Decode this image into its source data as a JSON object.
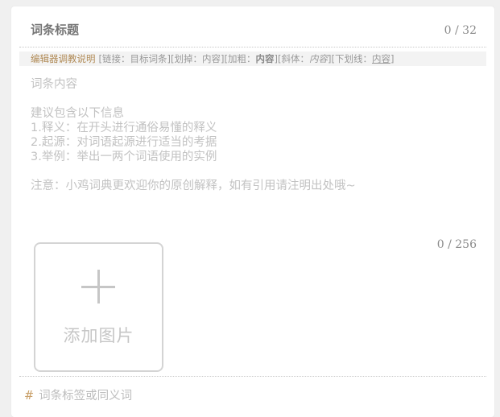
{
  "title": {
    "placeholder": "词条标题",
    "count": "0 / 32"
  },
  "toolbar": {
    "help_label": "编辑器调教说明",
    "link_open": "[链接：",
    "link_value": "目标词条",
    "link_close": "]",
    "strike_open": "[划掉：",
    "strike_value": "内容",
    "strike_close": "]",
    "bold_open": "[加粗：",
    "bold_value": "内容",
    "bold_close": "]",
    "italic_open": "[斜体：",
    "italic_value": "内容",
    "italic_close": "]",
    "underline_open": "[下划线：",
    "underline_value": "内容",
    "underline_close": "]"
  },
  "content": {
    "placeholder_lines": [
      "词条内容",
      "",
      "建议包含以下信息",
      "1.释义：在开头进行通俗易懂的释义",
      "2.起源：对词语起源进行适当的考据",
      "3.举例：举出一两个词语使用的实例",
      "",
      "注意：小鸡词典更欢迎你的原创解释，如有引用请注明出处哦~"
    ],
    "count": "0 / 256"
  },
  "upload": {
    "label": "添加图片",
    "icon": "plus-icon"
  },
  "tags": {
    "hash": "#",
    "placeholder": "词条标签或同义词"
  },
  "colors": {
    "accent": "#b08a55",
    "hash": "#c9a06a",
    "placeholder": "#c2c2c2",
    "counter": "#8a8a8a"
  }
}
